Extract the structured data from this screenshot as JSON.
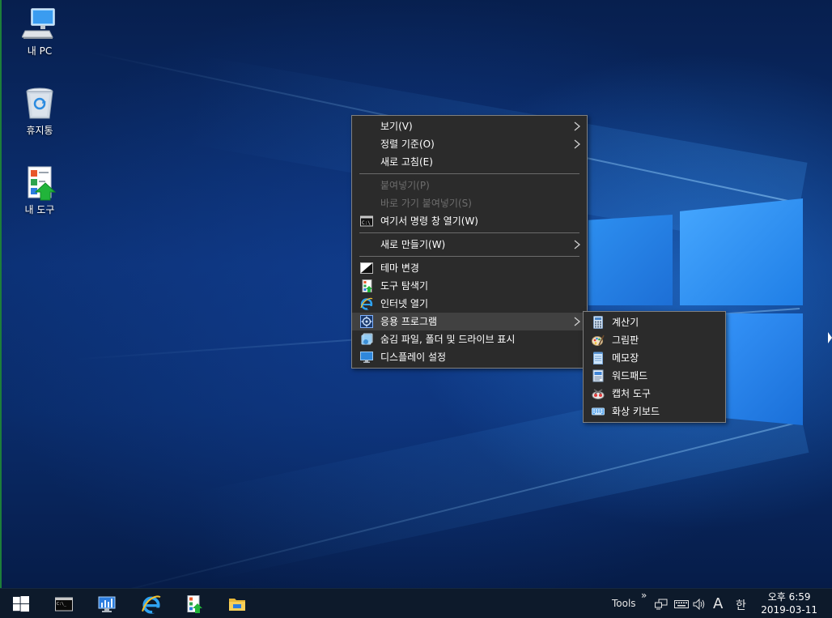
{
  "desktop": {
    "icons": [
      {
        "label": "내 PC",
        "icon": "computer-icon"
      },
      {
        "label": "휴지통",
        "icon": "recycle-bin-icon"
      },
      {
        "label": "내 도구",
        "icon": "my-tools-icon"
      }
    ]
  },
  "context_menu": {
    "items": [
      {
        "label": "보기(V)",
        "has_submenu": true
      },
      {
        "label": "정렬 기준(O)",
        "has_submenu": true
      },
      {
        "label": "새로 고침(E)"
      },
      {
        "label": "붙여넣기(P)",
        "disabled": true
      },
      {
        "label": "바로 가기 붙여넣기(S)",
        "disabled": true
      },
      {
        "label": "여기서 명령 창 열기(W)",
        "icon": "command-prompt-icon"
      },
      {
        "label": "새로 만들기(W)",
        "has_submenu": true
      },
      {
        "label": "테마 변경",
        "icon": "theme-icon"
      },
      {
        "label": "도구 탐색기",
        "icon": "tool-explorer-icon"
      },
      {
        "label": "인터넷 열기",
        "icon": "internet-explorer-icon"
      },
      {
        "label": "응용 프로그램",
        "icon": "applications-icon",
        "has_submenu": true,
        "highlighted": true
      },
      {
        "label": "숨김 파일, 폴더 및 드라이브 표시",
        "icon": "hidden-files-icon"
      },
      {
        "label": "디스플레이 설정",
        "icon": "display-icon"
      }
    ]
  },
  "submenu": {
    "items": [
      {
        "label": "계산기",
        "icon": "calculator-icon"
      },
      {
        "label": "그림판",
        "icon": "paint-icon"
      },
      {
        "label": "메모장",
        "icon": "notepad-icon"
      },
      {
        "label": "워드패드",
        "icon": "wordpad-icon"
      },
      {
        "label": "캡처 도구",
        "icon": "snipping-tool-icon"
      },
      {
        "label": "화상 키보드",
        "icon": "on-screen-keyboard-icon"
      }
    ]
  },
  "taskbar": {
    "toolbar_label": "Tools",
    "overflow_glyph": "»",
    "input_mode": "A",
    "ime_label": "한",
    "clock_time": "오후 6:59",
    "clock_date": "2019-03-11"
  },
  "colors": {
    "menu_bg": "#2b2b2b",
    "menu_highlight": "#414141",
    "menu_disabled_text": "#6d6d6d",
    "taskbar_bg": "#0d1a2b",
    "accent_blue": "#1f7ee6"
  }
}
